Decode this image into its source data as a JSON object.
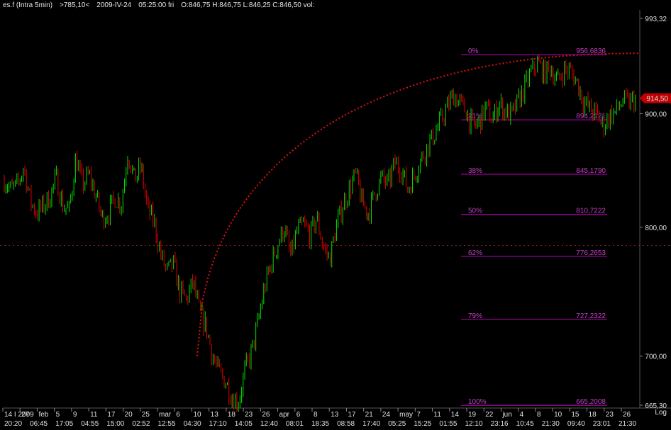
{
  "header": {
    "symbol": "es.f (Intra 5min)",
    "cursor_value": ">785,10<",
    "date": "2009-IV-24",
    "time": "05:25:00 fri",
    "ohlc": "O:846,75 H:846,75 L:846,25 C:846,50 vol:"
  },
  "price_badge": "914,50",
  "log_label": "Log",
  "colors": {
    "background": "#000000",
    "candle_up": "#00e000",
    "candle_down": "#e00000",
    "fib": "#c000c0",
    "arc": "#e01010",
    "badge": "#c00000"
  },
  "chart_data": {
    "type": "candlestick",
    "scale": "log",
    "ylim": [
      665.3,
      993.32
    ],
    "yticks": [
      "993,32",
      "900,00",
      "800,00",
      "700,00",
      "665,30"
    ],
    "ytick_values": [
      993.32,
      900,
      800,
      700,
      665.3
    ],
    "x_row1": [
      "14 I 2009",
      "27",
      "feb",
      "5",
      "9",
      "11",
      "17",
      "20",
      "25",
      "mar",
      "6",
      "10",
      "13",
      "18",
      "23",
      "26",
      "apr",
      "6",
      "8",
      "13",
      "17",
      "21",
      "24",
      "may",
      "7",
      "11",
      "14",
      "19",
      "22",
      "jun",
      "4",
      "8",
      "10",
      "15",
      "18",
      "23",
      "26"
    ],
    "x_row2": [
      "20:20",
      "06:45",
      "17:05",
      "04:55",
      "15:00",
      "02:52",
      "12:55",
      "04:30",
      "17:10",
      "14:05",
      "12:40",
      "08:01",
      "18:35",
      "08:58",
      "17:40",
      "05:25",
      "15:25",
      "01:55",
      "12:10",
      "23:16",
      "10:45",
      "21:30",
      "09:40",
      "23:01",
      "21:30"
    ],
    "price_path": [
      840,
      832,
      835,
      852,
      822,
      812,
      818,
      826,
      842,
      818,
      814,
      860,
      836,
      845,
      828,
      808,
      812,
      825,
      820,
      865,
      840,
      852,
      815,
      805,
      778,
      764,
      770,
      748,
      742,
      756,
      732,
      722,
      700,
      688,
      682,
      671,
      668,
      690,
      703,
      725,
      752,
      770,
      786,
      800,
      776,
      797,
      802,
      793,
      808,
      784,
      774,
      800,
      818,
      832,
      845,
      820,
      812,
      830,
      842,
      836,
      855,
      850,
      832,
      845,
      858,
      870,
      880,
      892,
      905,
      918,
      910,
      902,
      887,
      892,
      906,
      894,
      910,
      902,
      898,
      912,
      925,
      940,
      948,
      938,
      944,
      930,
      942,
      940,
      930,
      912,
      904,
      900,
      888,
      898,
      902,
      912,
      910,
      914
    ],
    "fib_levels": [
      {
        "pct": "0%",
        "value": "956,6836"
      },
      {
        "pct": "21%",
        "value": "894,2121"
      },
      {
        "pct": "38%",
        "value": "845,1790"
      },
      {
        "pct": "50%",
        "value": "810,7222"
      },
      {
        "pct": "62%",
        "value": "776,2653"
      },
      {
        "pct": "79%",
        "value": "727,2322"
      },
      {
        "pct": "100%",
        "value": "665,2008"
      }
    ],
    "last_price": 914.5
  }
}
